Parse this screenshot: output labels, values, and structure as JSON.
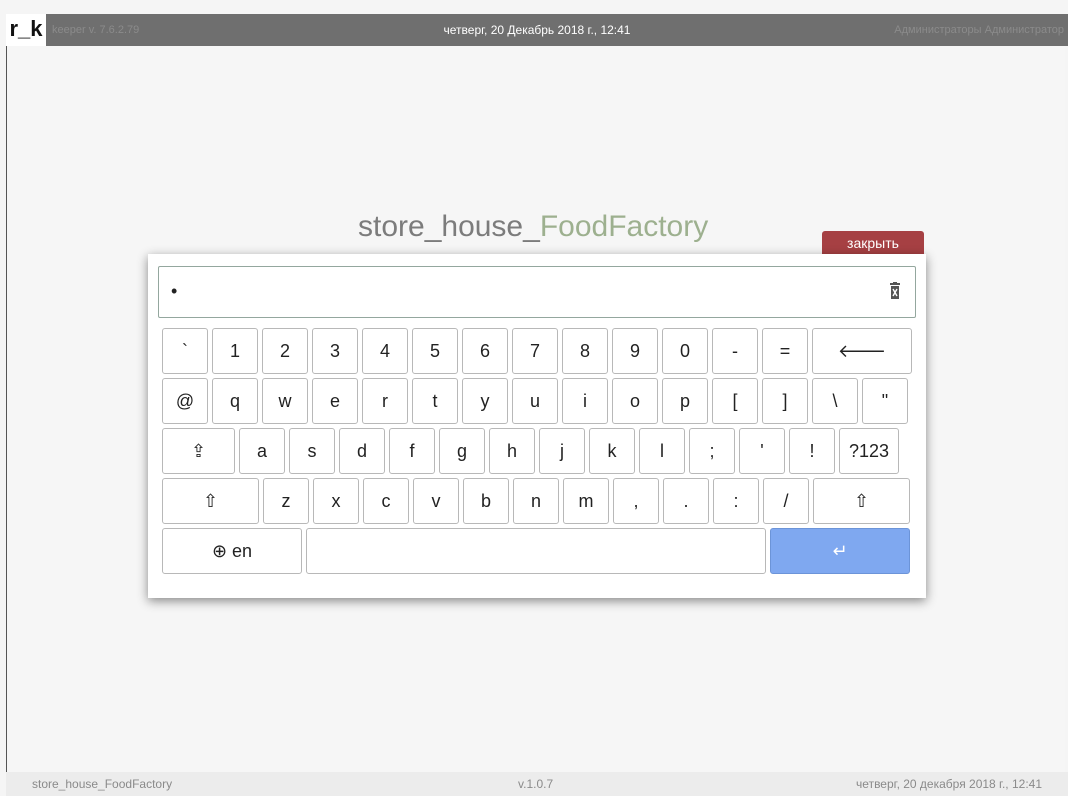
{
  "topbar": {
    "logo": "r_k",
    "version": "keeper v. 7.6.2.79",
    "datetime": "четверг, 20 Декабрь 2018 г., 12:41",
    "user": "Администраторы Администратор"
  },
  "title": {
    "main": "store_house_",
    "accent": "FoodFactory"
  },
  "close_label": "закрыть",
  "input": {
    "value": "•",
    "clear_icon": "trash-icon"
  },
  "keyboard": {
    "row1": [
      "`",
      "1",
      "2",
      "3",
      "4",
      "5",
      "6",
      "7",
      "8",
      "9",
      "0",
      "-",
      "=",
      "🡐"
    ],
    "row2": [
      "@",
      "q",
      "w",
      "e",
      "r",
      "t",
      "y",
      "u",
      "i",
      "o",
      "p",
      "[",
      "]",
      "\\",
      "\""
    ],
    "row3": [
      "⇪",
      "a",
      "s",
      "d",
      "f",
      "g",
      "h",
      "j",
      "k",
      "l",
      ";",
      "'",
      "!",
      "?123"
    ],
    "row4": [
      "⇧",
      "z",
      "x",
      "c",
      "v",
      "b",
      "n",
      "m",
      ",",
      ".",
      ":",
      "/",
      "⇧"
    ],
    "lang": "⊕ en",
    "enter": "↵",
    "enter_color": "#7fa8f0"
  },
  "status": {
    "left": "store_house_FoodFactory",
    "center": "v.1.0.7",
    "right": "четверг, 20 декабря 2018 г., 12:41"
  }
}
